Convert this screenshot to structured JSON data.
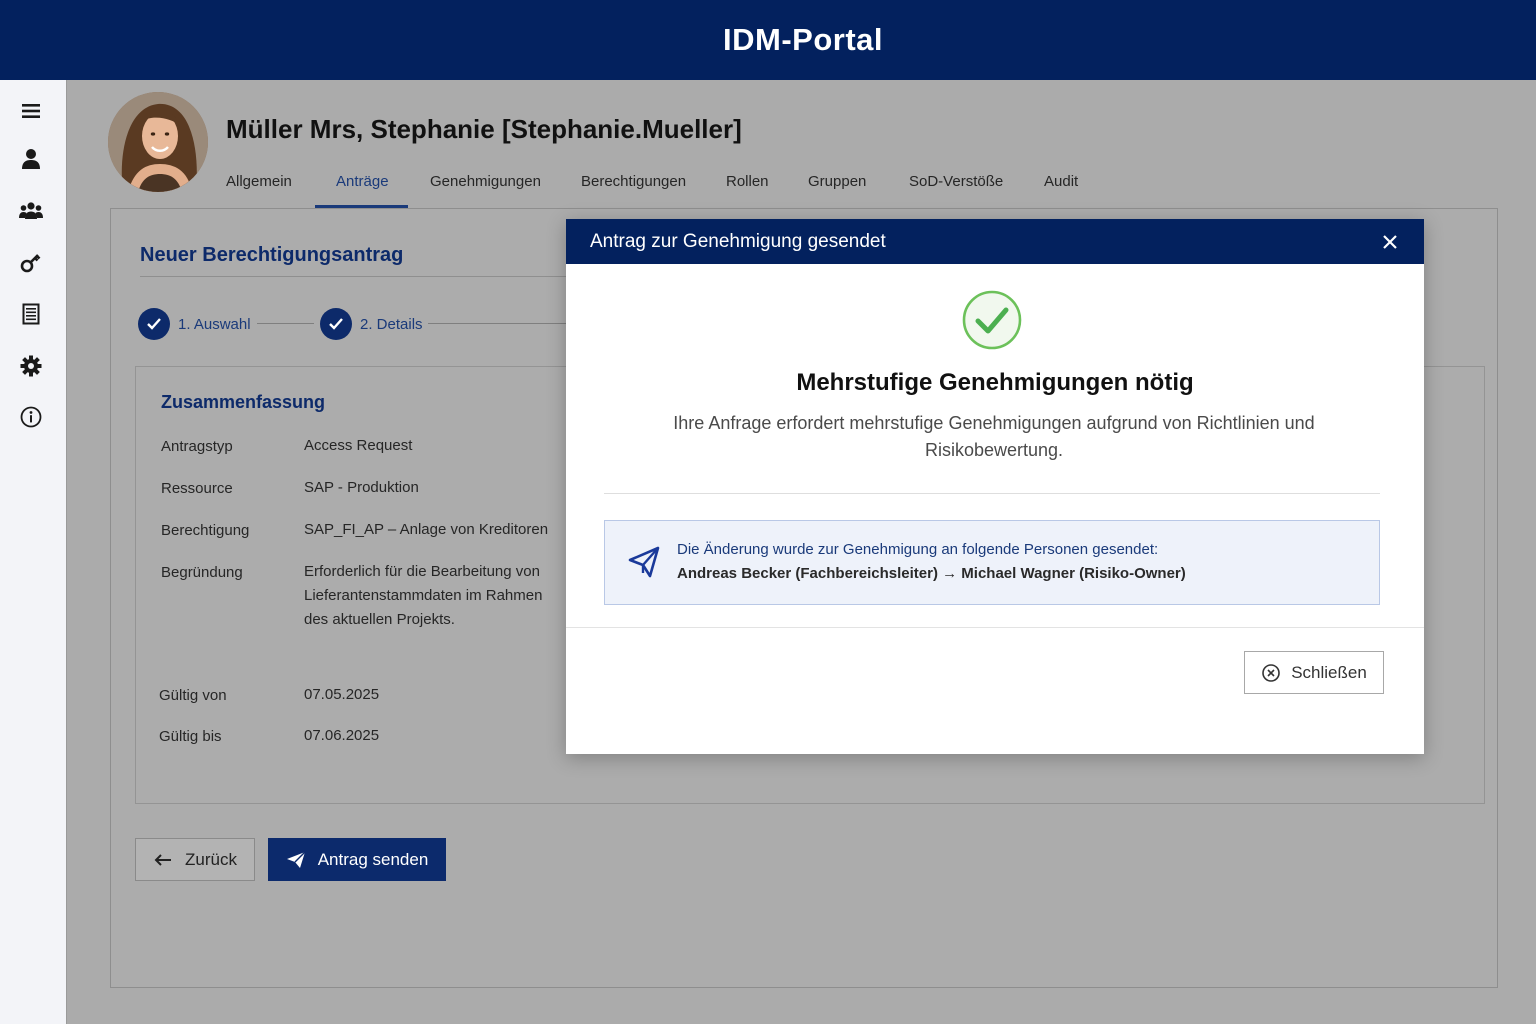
{
  "app": {
    "title": "IDM-Portal"
  },
  "sidebar": {
    "icons": [
      "menu-icon",
      "user-icon",
      "group-icon",
      "key-icon",
      "document-icon",
      "gear-icon",
      "info-icon"
    ]
  },
  "user": {
    "name": "Müller Mrs, Stephanie [Stephanie.Mueller]"
  },
  "tabs": [
    {
      "label": "Allgemein"
    },
    {
      "label": "Anträge",
      "active": true
    },
    {
      "label": "Genehmigungen"
    },
    {
      "label": "Berechtigungen"
    },
    {
      "label": "Rollen"
    },
    {
      "label": "Gruppen"
    },
    {
      "label": "SoD-Verstöße"
    },
    {
      "label": "Audit"
    }
  ],
  "form": {
    "title": "Neuer Berechtigungsantrag",
    "steps": [
      {
        "label": "1. Auswahl",
        "done": true
      },
      {
        "label": "2. Details",
        "done": true
      }
    ],
    "summary": {
      "title": "Zusammenfassung",
      "rows": [
        {
          "label": "Antragstyp",
          "value": "Access Request"
        },
        {
          "label": "Ressource",
          "value": "SAP - Produktion"
        },
        {
          "label": "Berechtigung",
          "value": "SAP_FI_AP – Anlage von Kreditoren"
        },
        {
          "label": "Begründung",
          "value": "Erforderlich für die Bearbeitung von Lieferantenstammdaten im Rahmen des aktuellen Projekts."
        },
        {
          "label": "Gültig von",
          "value": "07.05.2025"
        },
        {
          "label": "Gültig bis",
          "value": "07.06.2025"
        }
      ]
    },
    "back_label": "Zurück",
    "send_label": "Antrag senden"
  },
  "modal": {
    "title": "Antrag zur Genehmigung gesendet",
    "heading": "Mehrstufige Genehmigungen nötig",
    "description": "Ihre Anfrage erfordert mehrstufige Genehmigungen aufgrund von Richtlinien und Risikobewertung.",
    "info_line1": "Die Änderung wurde zur Genehmigung an folgende Personen gesendet:",
    "info_line2": "Andreas Becker (Fachbereichsleiter) → Michael Wagner (Risiko-Owner)",
    "close_label": "Schließen"
  },
  "colors": {
    "brand": "#03215e",
    "accent": "#0d2a6a",
    "success": "#4caf50"
  }
}
